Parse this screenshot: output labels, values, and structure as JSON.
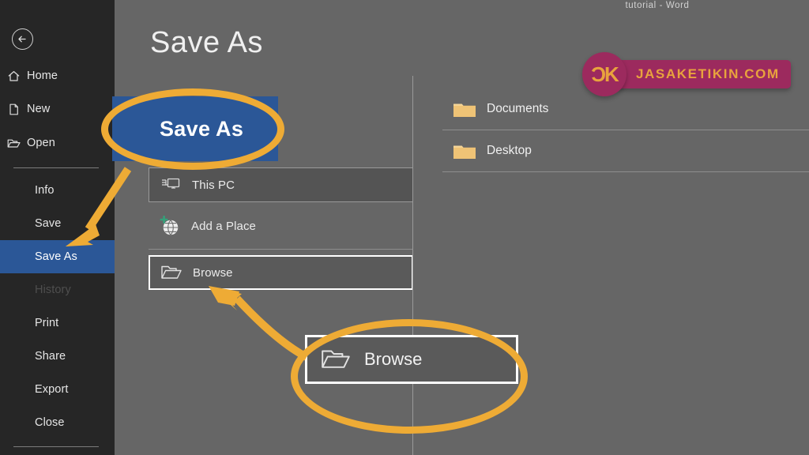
{
  "window": {
    "document_title": "tutorial  -  Word"
  },
  "page": {
    "title": "Save As"
  },
  "sidebar": {
    "back_label": "Back",
    "back_icon": "arrow-left-circle-icon",
    "top_items": [
      {
        "label": "Home",
        "icon": "home-icon"
      },
      {
        "label": "New",
        "icon": "new-document-icon"
      },
      {
        "label": "Open",
        "icon": "open-folder-icon"
      }
    ],
    "items": [
      {
        "label": "Info",
        "state": "normal"
      },
      {
        "label": "Save",
        "state": "normal"
      },
      {
        "label": "Save As",
        "state": "selected"
      },
      {
        "label": "History",
        "state": "disabled"
      },
      {
        "label": "Print",
        "state": "normal"
      },
      {
        "label": "Share",
        "state": "normal"
      },
      {
        "label": "Export",
        "state": "normal"
      },
      {
        "label": "Close",
        "state": "normal"
      }
    ]
  },
  "places": [
    {
      "label": "This PC",
      "icon": "this-pc-icon",
      "style": "boxed-soft"
    },
    {
      "label": "Add a Place",
      "icon": "add-a-place-icon",
      "style": "plain"
    },
    {
      "label": "Browse",
      "icon": "folder-open-icon",
      "style": "boxed-strong"
    }
  ],
  "folders": [
    {
      "label": "Documents",
      "icon": "folder-icon"
    },
    {
      "label": "Desktop",
      "icon": "folder-icon"
    }
  ],
  "watermark": {
    "mark": "ƆK",
    "text": "JASAKETIKIN.COM",
    "circle_color": "#9c2a5e",
    "text_color": "#e8a33d"
  },
  "callouts": {
    "save_as": {
      "label": "Save As",
      "ring_color": "#eeab35",
      "fill_color": "#2b5797"
    },
    "browse": {
      "label": "Browse",
      "icon": "folder-open-icon",
      "ring_color": "#eeab35"
    }
  },
  "colors": {
    "sidebar_bg": "#262626",
    "main_bg": "#666666",
    "accent_blue": "#2b5797",
    "annotation_orange": "#eeab35",
    "folder_gold": "#efc376"
  }
}
